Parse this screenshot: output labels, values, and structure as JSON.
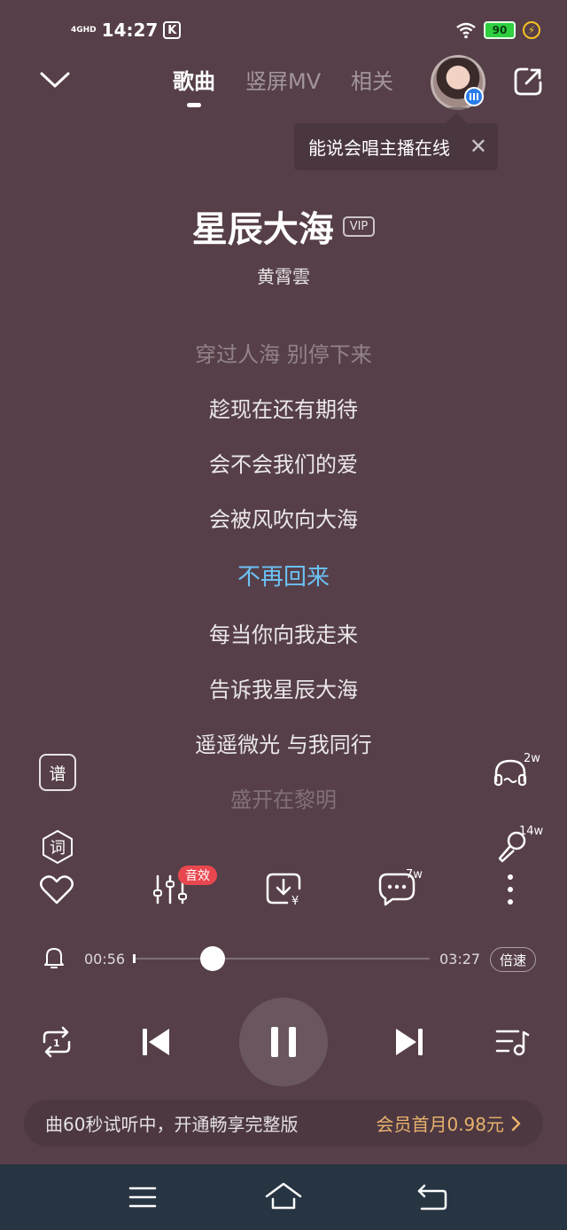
{
  "status_bar": {
    "network": "4GHD",
    "time": "14:27",
    "app_badge": "K",
    "battery": "90"
  },
  "tabs": [
    {
      "label": "歌曲"
    },
    {
      "label": "竖屏MV"
    },
    {
      "label": "相关"
    }
  ],
  "tooltip": {
    "text": "能说会唱主播在线"
  },
  "song": {
    "title": "星辰大海",
    "vip": "VIP",
    "artist": "黄霄雲"
  },
  "lyrics": [
    "穿过人海 别停下来",
    "趁现在还有期待",
    "会不会我们的爱",
    "会被风吹向大海",
    "不再回来",
    "每当你向我走来",
    "告诉我星辰大海",
    "遥遥微光 与我同行",
    "盛开在黎明"
  ],
  "side_buttons": {
    "score_label": "谱",
    "lyric_label": "词",
    "listen_count": "2w",
    "sing_count": "14w"
  },
  "actions": {
    "sound_effect_badge": "音效",
    "comment_count": "7w"
  },
  "progress": {
    "current": "00:56",
    "total": "03:27",
    "fraction": 0.27,
    "speed_label": "倍速"
  },
  "banner": {
    "message": "曲60秒试听中，开通畅享完整版",
    "offer": "会员首月0.98元"
  },
  "colors": {
    "background": "#563f49",
    "current_lyric": "#6cc2f5",
    "offer": "#e8b26b",
    "badge": "#e9474f",
    "nav": "#273441"
  }
}
